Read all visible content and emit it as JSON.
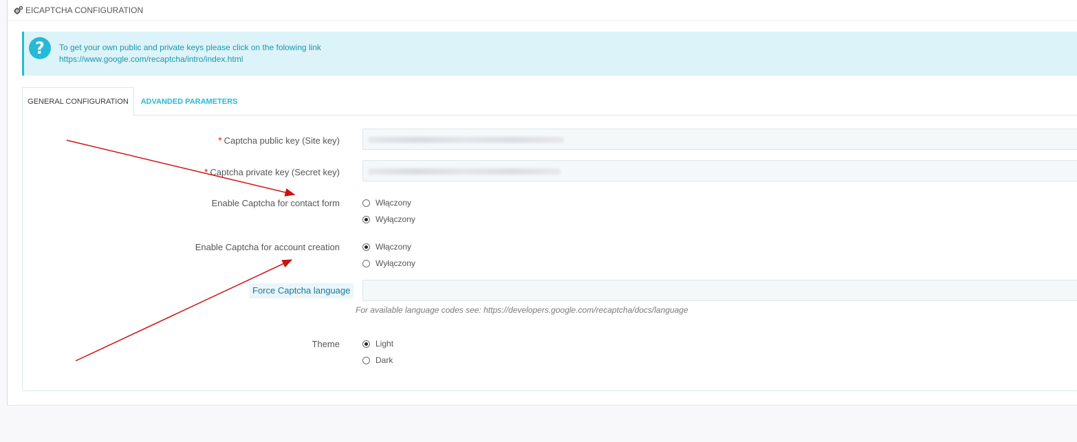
{
  "panel": {
    "title": "EICAPTCHA CONFIGURATION",
    "title_icon": "cogs-icon"
  },
  "info": {
    "icon": "question-circle-icon",
    "line1": "To get your own public and private keys please click on the folowing link",
    "line2": "https://www.google.com/recaptcha/intro/index.html",
    "accent_color": "#25b9d7"
  },
  "tabs": [
    {
      "label": "GENERAL CONFIGURATION",
      "active": true
    },
    {
      "label": "ADVANDED PARAMETERS",
      "active": false
    }
  ],
  "form": {
    "public_key": {
      "required_mark": "*",
      "label": "Captcha public key (Site key)",
      "value_redacted": true
    },
    "private_key": {
      "required_mark": "*",
      "label": "Captcha private key (Secret key)",
      "value_redacted": true
    },
    "contact_form": {
      "label": "Enable Captcha for contact form",
      "options": [
        {
          "label": "Włączony",
          "checked": false
        },
        {
          "label": "Wyłączony",
          "checked": true
        }
      ]
    },
    "account_creation": {
      "label": "Enable Captcha for account creation",
      "options": [
        {
          "label": "Włączony",
          "checked": true
        },
        {
          "label": "Wyłączony",
          "checked": false
        }
      ]
    },
    "language": {
      "label": "Force Captcha language",
      "value": "",
      "help": "For available language codes see: https://developers.google.com/recaptcha/docs/language"
    },
    "theme": {
      "label": "Theme",
      "options": [
        {
          "label": "Light",
          "checked": true
        },
        {
          "label": "Dark",
          "checked": false
        }
      ]
    }
  },
  "annotation": {
    "arrow_color": "#cc1111"
  }
}
